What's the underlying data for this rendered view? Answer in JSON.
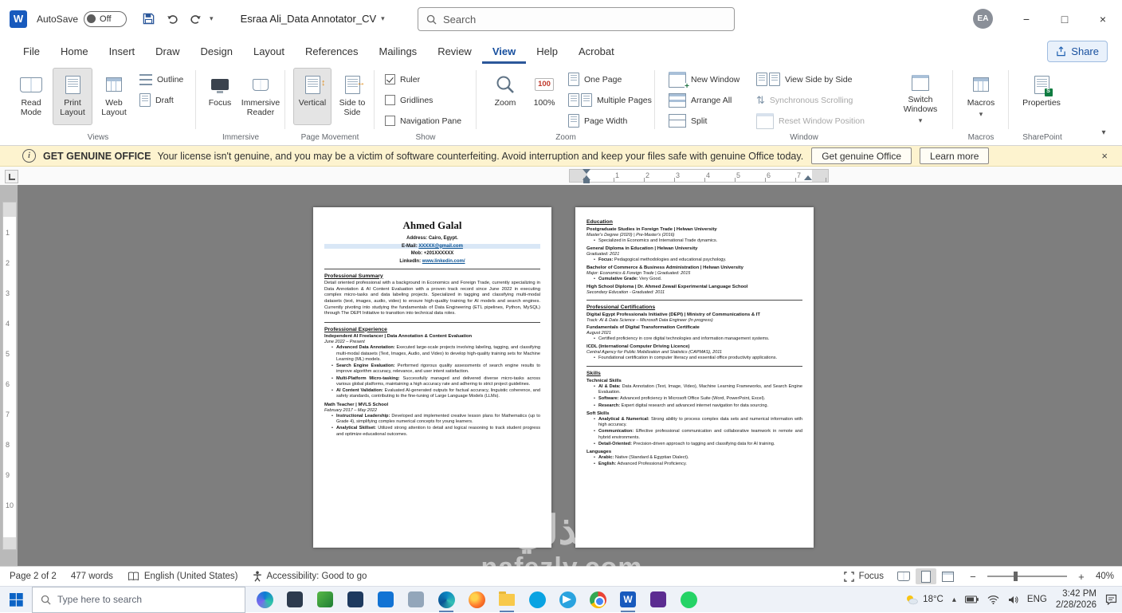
{
  "titlebar": {
    "autosave_label": "AutoSave",
    "autosave_state": "Off",
    "doc_title": "Esraa Ali_Data Annotator_CV",
    "search_placeholder": "Search",
    "avatar_initials": "EA"
  },
  "menubar": {
    "tabs": [
      "File",
      "Home",
      "Insert",
      "Draw",
      "Design",
      "Layout",
      "References",
      "Mailings",
      "Review",
      "View",
      "Help",
      "Acrobat"
    ],
    "active_tab": "View",
    "share": "Share"
  },
  "ribbon": {
    "views": {
      "label": "Views",
      "read_mode": "Read Mode",
      "print_layout": "Print Layout",
      "web_layout": "Web Layout",
      "outline": "Outline",
      "draft": "Draft"
    },
    "immersive": {
      "label": "Immersive",
      "focus": "Focus",
      "immersive_reader": "Immersive Reader"
    },
    "page_movement": {
      "label": "Page Movement",
      "vertical": "Vertical",
      "side_to_side": "Side to Side"
    },
    "show": {
      "label": "Show",
      "ruler": "Ruler",
      "gridlines": "Gridlines",
      "navigation_pane": "Navigation Pane"
    },
    "zoom": {
      "label": "Zoom",
      "zoom": "Zoom",
      "percent": "100%",
      "one_page": "One Page",
      "multiple_pages": "Multiple Pages",
      "page_width": "Page Width"
    },
    "window": {
      "label": "Window",
      "new_window": "New Window",
      "arrange_all": "Arrange All",
      "split": "Split",
      "view_side_by_side": "View Side by Side",
      "synchronous_scrolling": "Synchronous Scrolling",
      "reset_window_position": "Reset Window Position",
      "switch_windows": "Switch Windows"
    },
    "macros": {
      "label": "Macros",
      "macros": "Macros"
    },
    "sharepoint": {
      "label": "SharePoint",
      "properties": "Properties"
    }
  },
  "banner": {
    "title": "GET GENUINE OFFICE",
    "message": "Your license isn't genuine, and you may be a victim of software counterfeiting. Avoid interruption and keep your files safe with genuine Office today.",
    "get_button": "Get genuine Office",
    "learn_button": "Learn more"
  },
  "ruler": {
    "h_numbers": [
      "1",
      "2",
      "3",
      "4",
      "5",
      "6",
      "7"
    ],
    "v_numbers": [
      "1",
      "2",
      "3",
      "4",
      "5",
      "6",
      "7",
      "8",
      "9",
      "10"
    ]
  },
  "statusbar": {
    "page_info": "Page 2 of 2",
    "word_count": "477 words",
    "language": "English (United States)",
    "accessibility": "Accessibility: Good to go",
    "focus": "Focus",
    "zoom_percent": "40%"
  },
  "taskbar": {
    "search_placeholder": "Type here to search",
    "temperature": "18°C",
    "language_badge": "ENG",
    "time": "3:42 PM",
    "date": "2/28/2026"
  },
  "watermark": {
    "arabic": "نفذلي",
    "latin": "nafezly.com"
  },
  "icons": {
    "word_logo": "W",
    "chevron_down": "▾",
    "chevron_up": "▴",
    "minimize": "−",
    "maximize": "□",
    "close": "×",
    "info": "i",
    "zoom_100": "100",
    "properties_badge": "S",
    "arrow_updown": "↕",
    "arrow_leftright": "↔",
    "sync_arrows": "⇅",
    "switch_arrows": "⇄",
    "zoom_out": "−",
    "zoom_in": "+"
  },
  "colors": {
    "accent": "#185abd",
    "banner_bg": "#fdf3cf",
    "canvas": "#7e7e7e",
    "link": "#0b5394",
    "highlight": "#d9e7f6"
  },
  "document": {
    "page1": {
      "name": "Ahmed Galal",
      "contact": [
        {
          "label": "Address:",
          "value": "Cairo, Egypt."
        },
        {
          "label": "E-Mail:",
          "value": "XXXXX@gmail.com",
          "link": true,
          "highlight": true
        },
        {
          "label": "Mob:",
          "value": "+201XXXXXX"
        },
        {
          "label": "LinkedIn:",
          "value": "www.linkedin.com/",
          "link": true
        }
      ],
      "sections": [
        {
          "heading": "Professional Summary",
          "paragraphs": [
            "Detail oriented professional with a background in Economics and Foreign Trade, currently specializing in Data Annotation & AI Content Evaluation with a proven track record since June 2022 in executing complex micro-tasks and data labeling projects. Specialized in tagging and classifying multi-modal datasets (text, images, audio, video) to ensure high-quality training for AI models and search engines. Currently pivoting into studying the fundamentals of Data Engineering (ETL pipelines, Python, MySQL) through The DEPI Initiative to transition into technical data roles."
          ]
        },
        {
          "heading": "Professional Experience",
          "entries": [
            {
              "title": "Independent AI Freelancer | Data Annotation & Content Evaluation",
              "subtitle": "June 2022 – Present",
              "bullets": [
                {
                  "lead": "Advanced Data Annotation:",
                  "text": "Executed large-scale projects involving labeling, tagging, and classifying multi-modal datasets (Text, Images, Audio, and Video) to develop high-quality training sets for Machine Learning (ML) models."
                },
                {
                  "lead": "Search Engine Evaluation:",
                  "text": "Performed rigorous quality assessments of search engine results to improve algorithm accuracy, relevance, and user intent satisfaction."
                },
                {
                  "lead": "Multi-Platform Micro-tasking:",
                  "text": "Successfully managed and delivered diverse micro-tasks across various global platforms, maintaining a high accuracy rate and adhering to strict project guidelines."
                },
                {
                  "lead": "AI Content Validation:",
                  "text": "Evaluated AI-generated outputs for factual accuracy, linguistic coherence, and safety standards, contributing to the fine-tuning of Large Language Models (LLMs)."
                }
              ]
            },
            {
              "title": "Math Teacher | MVLS School",
              "subtitle": "February 2017 – May 2022",
              "bullets": [
                {
                  "lead": "Instructional Leadership:",
                  "text": "Developed and implemented creative lesson plans for Mathematics (up to Grade 4), simplifying complex numerical concepts for young learners."
                },
                {
                  "lead": "Analytical Skillset:",
                  "text": "Utilized strong attention to detail and logical reasoning to track student progress and optimize educational outcomes."
                }
              ]
            }
          ]
        }
      ]
    },
    "page2": {
      "sections": [
        {
          "heading": "Education",
          "entries": [
            {
              "title": "Postgraduate Studies in Foreign Trade | Helwan University",
              "subtitle": "Master's Degree (2020) | Pre-Master's (2016)",
              "bullets": [
                {
                  "text": "Specialized in Economics and International Trade dynamics."
                }
              ]
            },
            {
              "title": "General Diploma in Education | Helwan University",
              "subtitle": "Graduated: 2021",
              "bullets": [
                {
                  "lead": "Focus:",
                  "text": "Pedagogical methodologies and educational psychology."
                }
              ]
            },
            {
              "title": "Bachelor of Commerce & Business Administration | Helwan University",
              "subtitle": "Major: Economics & Foreign Trade | Graduated: 2015",
              "bullets": [
                {
                  "lead": "Cumulative Grade:",
                  "text": "Very Good."
                }
              ]
            },
            {
              "title": "High School Diploma | Dr. Ahmed Zewail Experimental Language School",
              "subtitle": "Secondary Education - Graduated: 2011",
              "bullets": []
            }
          ]
        },
        {
          "heading": "Professional Certifications",
          "entries": [
            {
              "title": "Digital Egypt Professionals Initiative (DEPI) | Ministry of Communications & IT",
              "subtitle": "Track: AI & Data Science – Microsoft Data Engineer (In progress)",
              "bullets": []
            },
            {
              "title": "Fundamentals of Digital Transformation Certificate",
              "subtitle": "August 2021",
              "bullets": [
                {
                  "text": "Certified proficiency in core digital technologies and information management systems."
                }
              ]
            },
            {
              "title": "ICDL (International Computer Driving Licence)",
              "subtitle": "Central Agency for Public Mobilization and Statistics (CAPMAS), 2011",
              "bullets": [
                {
                  "text": "Foundational certification in computer literacy and essential office productivity applications."
                }
              ]
            }
          ]
        },
        {
          "heading": "Skills",
          "entries": [
            {
              "title": "Technical Skills",
              "bullets": [
                {
                  "lead": "AI & Data:",
                  "text": "Data Annotation (Text, Image, Video), Machine Learning Frameworks, and Search Engine Evaluation."
                },
                {
                  "lead": "Software:",
                  "text": "Advanced proficiency in Microsoft Office Suite (Word, PowerPoint, Excel)."
                },
                {
                  "lead": "Research:",
                  "text": "Expert digital research and advanced internet navigation for data sourcing."
                }
              ]
            },
            {
              "title": "Soft Skills",
              "bullets": [
                {
                  "lead": "Analytical & Numerical:",
                  "text": "Strong ability to process complex data sets and numerical information with high accuracy."
                },
                {
                  "lead": "Communication:",
                  "text": "Effective professional communication and collaborative teamwork in remote and hybrid environments."
                },
                {
                  "lead": "Detail-Oriented:",
                  "text": "Precision-driven approach to tagging and classifying data for AI training."
                }
              ]
            },
            {
              "title": "Languages",
              "bullets": [
                {
                  "lead": "Arabic:",
                  "text": "Native (Standard & Egyptian Dialect)."
                },
                {
                  "lead": "English:",
                  "text": "Advanced Professional Proficiency."
                }
              ]
            }
          ]
        }
      ]
    }
  }
}
